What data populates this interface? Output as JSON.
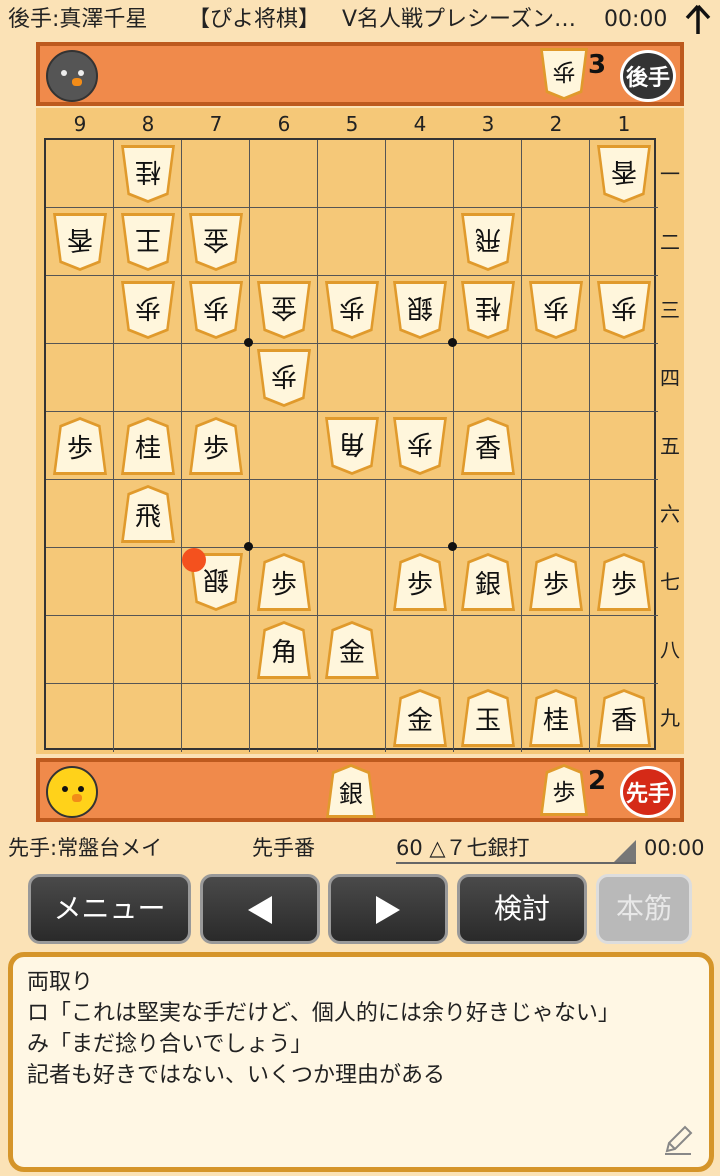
{
  "header": {
    "gote_player": "後手:真澤千星",
    "app_name": "【ぴよ将棋】",
    "event": "V名人戦プレシーズン…",
    "gote_time": "00:00"
  },
  "gote_stand": {
    "badge": "後手",
    "hand": [
      {
        "piece": "歩",
        "count": "3"
      }
    ]
  },
  "sente_stand": {
    "badge": "先手",
    "hand": [
      {
        "piece": "銀",
        "count": ""
      },
      {
        "piece": "歩",
        "count": "2"
      }
    ]
  },
  "board": {
    "file_labels": [
      "9",
      "8",
      "7",
      "6",
      "5",
      "4",
      "3",
      "2",
      "1"
    ],
    "rank_labels": [
      "一",
      "二",
      "三",
      "四",
      "五",
      "六",
      "七",
      "八",
      "九"
    ],
    "pieces": [
      {
        "file": 8,
        "rank": 1,
        "piece": "桂",
        "side": "gote"
      },
      {
        "file": 1,
        "rank": 1,
        "piece": "香",
        "side": "gote"
      },
      {
        "file": 9,
        "rank": 2,
        "piece": "香",
        "side": "gote"
      },
      {
        "file": 8,
        "rank": 2,
        "piece": "王",
        "side": "gote"
      },
      {
        "file": 7,
        "rank": 2,
        "piece": "金",
        "side": "gote"
      },
      {
        "file": 3,
        "rank": 2,
        "piece": "飛",
        "side": "gote"
      },
      {
        "file": 8,
        "rank": 3,
        "piece": "歩",
        "side": "gote"
      },
      {
        "file": 7,
        "rank": 3,
        "piece": "歩",
        "side": "gote"
      },
      {
        "file": 6,
        "rank": 3,
        "piece": "金",
        "side": "gote"
      },
      {
        "file": 5,
        "rank": 3,
        "piece": "歩",
        "side": "gote"
      },
      {
        "file": 4,
        "rank": 3,
        "piece": "銀",
        "side": "gote"
      },
      {
        "file": 3,
        "rank": 3,
        "piece": "桂",
        "side": "gote"
      },
      {
        "file": 2,
        "rank": 3,
        "piece": "歩",
        "side": "gote"
      },
      {
        "file": 1,
        "rank": 3,
        "piece": "歩",
        "side": "gote"
      },
      {
        "file": 6,
        "rank": 4,
        "piece": "歩",
        "side": "gote"
      },
      {
        "file": 9,
        "rank": 5,
        "piece": "歩",
        "side": "sente"
      },
      {
        "file": 8,
        "rank": 5,
        "piece": "桂",
        "side": "sente"
      },
      {
        "file": 7,
        "rank": 5,
        "piece": "歩",
        "side": "sente"
      },
      {
        "file": 5,
        "rank": 5,
        "piece": "角",
        "side": "gote"
      },
      {
        "file": 4,
        "rank": 5,
        "piece": "歩",
        "side": "gote"
      },
      {
        "file": 3,
        "rank": 5,
        "piece": "香",
        "side": "sente"
      },
      {
        "file": 8,
        "rank": 6,
        "piece": "飛",
        "side": "sente"
      },
      {
        "file": 7,
        "rank": 7,
        "piece": "銀",
        "side": "gote"
      },
      {
        "file": 6,
        "rank": 7,
        "piece": "歩",
        "side": "sente"
      },
      {
        "file": 4,
        "rank": 7,
        "piece": "歩",
        "side": "sente"
      },
      {
        "file": 3,
        "rank": 7,
        "piece": "銀",
        "side": "sente"
      },
      {
        "file": 2,
        "rank": 7,
        "piece": "歩",
        "side": "sente"
      },
      {
        "file": 1,
        "rank": 7,
        "piece": "歩",
        "side": "sente"
      },
      {
        "file": 6,
        "rank": 8,
        "piece": "角",
        "side": "sente"
      },
      {
        "file": 5,
        "rank": 8,
        "piece": "金",
        "side": "sente"
      },
      {
        "file": 4,
        "rank": 9,
        "piece": "金",
        "side": "sente"
      },
      {
        "file": 3,
        "rank": 9,
        "piece": "玉",
        "side": "sente"
      },
      {
        "file": 2,
        "rank": 9,
        "piece": "桂",
        "side": "sente"
      },
      {
        "file": 1,
        "rank": 9,
        "piece": "香",
        "side": "sente"
      }
    ],
    "last_move": {
      "file": 7,
      "rank": 7
    }
  },
  "status": {
    "sente_player": "先手:常盤台メイ",
    "turn": "先手番",
    "move": "60 △７七銀打",
    "sente_time": "00:00"
  },
  "buttons": {
    "menu": "メニュー",
    "study": "検討",
    "mainline": "本筋"
  },
  "comment": {
    "lines": [
      "両取り",
      "ロ「これは堅実な手だけど、個人的には余り好きじゃない」",
      "み「まだ捻り合いでしょう」",
      "記者も好きではない、いくつか理由がある"
    ]
  },
  "colors": {
    "background": "#fbe2b6",
    "stand": "#f08a4b",
    "board": "#f5c878",
    "last_move_marker": "#f4511e"
  }
}
